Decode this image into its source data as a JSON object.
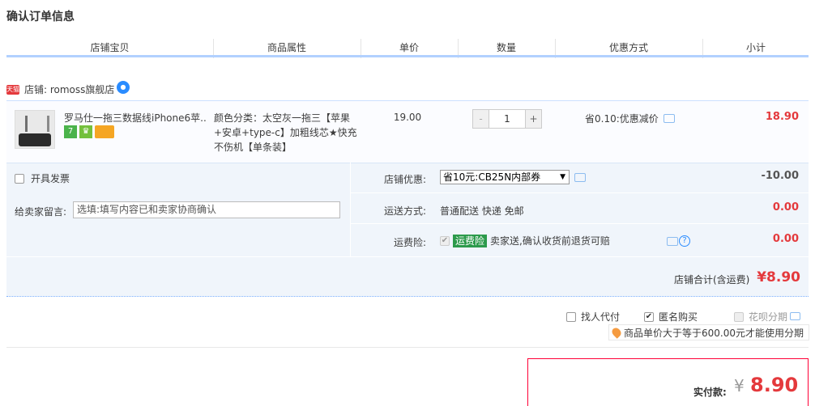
{
  "page": {
    "title": "确认订单信息"
  },
  "table_headers": [
    "店铺宝贝",
    "商品属性",
    "单价",
    "数量",
    "优惠方式",
    "小计"
  ],
  "shop": {
    "badge": "天猫",
    "label": "店铺: romoss旗舰店"
  },
  "item": {
    "name": "罗马仕一拖三数据线iPhone6苹...",
    "sku": "颜色分类：太空灰一拖三【苹果+安卓+type-c】加粗线芯★快充不伤机【单条装】",
    "unit_price": "19.00",
    "quantity": "1",
    "qty_minus": "-",
    "qty_plus": "+",
    "promo": "省0.10:优惠减价",
    "subtotal": "18.90"
  },
  "options": {
    "invoice_label": "开具发票",
    "memo_label": "给卖家留言:",
    "memo_value": "选填:填写内容已和卖家协商确认",
    "shop_coupon_label": "店铺优惠:",
    "shop_coupon_selected": "省10元:CB25N内部券",
    "shop_coupon_value": "-10.00",
    "shipping_label": "运送方式:",
    "shipping_text": "普通配送 快递 免邮",
    "shipping_value": "0.00",
    "insurance_label": "运费险:",
    "insurance_tag": "运费险",
    "insurance_text": "卖家送,确认收货前退货可赔",
    "insurance_value": "0.00",
    "shop_total_label": "店铺合计(含运费)",
    "shop_total_value": "¥8.90"
  },
  "extra_options": {
    "proxy_pay": "找人代付",
    "anonymous": "匿名购买",
    "huabei": "花呗分期",
    "huabei_tip": "商品单价大于等于600.00元才能使用分期"
  },
  "payment": {
    "label": "实付款:",
    "currency": "¥",
    "amount": "8.90"
  },
  "colors": {
    "accent_red": "#e4393c",
    "header_line": "#b2d1ff",
    "option_bg": "#f0f5fb"
  }
}
